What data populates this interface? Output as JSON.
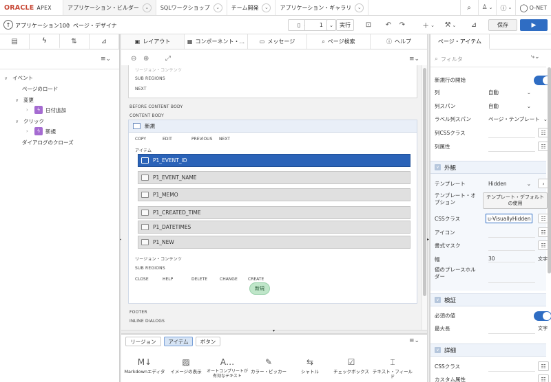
{
  "topnav": {
    "brand": "ORACLE",
    "product": "APEX",
    "tabs": [
      "アプリケーション・ビルダー",
      "SQLワークショップ",
      "チーム開発",
      "アプリケーション・ギャラリ"
    ],
    "user": "O-NET"
  },
  "toolbar": {
    "app_link": "アプリケーション100",
    "page_link": "ページ・デザイナ",
    "page_number": "1",
    "run_label": "実行",
    "save_label": "保存"
  },
  "left": {
    "tree": [
      {
        "label": "イベント",
        "level": 0
      },
      {
        "label": "ページのロード",
        "level": 1
      },
      {
        "label": "変更",
        "level": 1
      },
      {
        "label": "日付追加",
        "level": 2
      },
      {
        "label": "クリック",
        "level": 1
      },
      {
        "label": "新規",
        "level": 2
      },
      {
        "label": "ダイアログのクローズ",
        "level": 1
      }
    ]
  },
  "center": {
    "tabs": [
      "レイアウト",
      "コンポーネント・...",
      "メッセージ",
      "ページ検索",
      "ヘルプ"
    ],
    "top_labels": {
      "faded": "リージョン・コンテンツ",
      "sub_regions": "SUB REGIONS",
      "next": "NEXT"
    },
    "before_content": "BEFORE CONTENT BODY",
    "content_body": "CONTENT BODY",
    "region_title": "新規",
    "button_positions": [
      "COPY",
      "EDIT",
      "PREVIOUS",
      "NEXT"
    ],
    "items_label": "アイテム",
    "items": [
      "P1_EVENT_ID",
      "P1_EVENT_NAME",
      "P1_MEMO",
      "P1_CREATED_TIME",
      "P1_DATETIMES",
      "P1_NEW"
    ],
    "region_content": "リージョン・コンテンツ",
    "sub_regions": "SUB REGIONS",
    "bottom_positions": [
      "CLOSE",
      "HELP",
      "DELETE",
      "CHANGE",
      "CREATE"
    ],
    "new_button": "新規",
    "footer": "FOOTER",
    "inline_dialogs": "INLINE DIALOGS"
  },
  "gallery": {
    "tabs": [
      "リージョン",
      "アイテム",
      "ボタン"
    ],
    "items": [
      "Markdownエディタ",
      "イメージの表示",
      "オートコンプリートが有効なテキスト",
      "カラー・ピッカー",
      "シャトル",
      "チェックボックス",
      "テキスト・フィールド"
    ]
  },
  "right": {
    "tab": "ページ・アイテム",
    "filter_placeholder": "フィルタ",
    "rows_top": [
      {
        "label": "新規行の開始",
        "type": "toggle"
      },
      {
        "label": "列",
        "value": "自動",
        "type": "select"
      },
      {
        "label": "列スパン",
        "value": "自動",
        "type": "select"
      },
      {
        "label": "ラベル列スパン",
        "value": "ページ・テンプレート",
        "type": "select"
      },
      {
        "label": "列CSSクラス",
        "type": "list"
      },
      {
        "label": "列属性",
        "type": "list"
      }
    ],
    "sect_appearance": "外観",
    "template_label": "テンプレート",
    "template_value": "Hidden",
    "template_options_label": "テンプレート・オプション",
    "template_options_btn": "テンプレート・デフォルトの使用",
    "css_label": "CSSクラス",
    "css_value": "u-VisuallyHidden",
    "icon_label": "アイコン",
    "format_label": "書式マスク",
    "width_label": "幅",
    "width_value": "30",
    "width_unit": "文字",
    "placeholder_label": "値のプレースホルダー",
    "sect_validation": "検証",
    "required_label": "必須の値",
    "maxlen_label": "最大長",
    "maxlen_unit": "文字",
    "sect_advanced": "詳細",
    "adv_css_label": "CSSクラス",
    "custom_attr_label": "カスタム属性"
  }
}
